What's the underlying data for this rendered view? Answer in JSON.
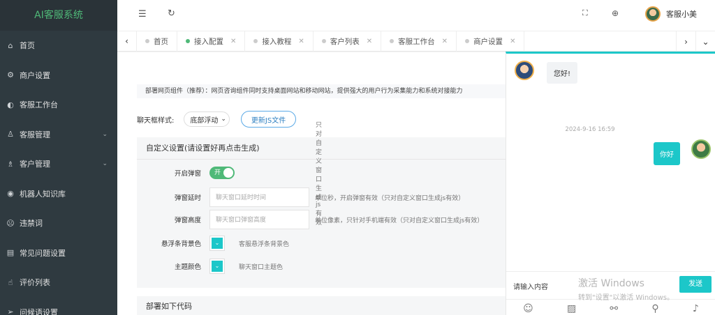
{
  "app": {
    "title": "AI客服系统"
  },
  "sidebar": {
    "items": [
      {
        "label": "首页",
        "icon": "home-icon"
      },
      {
        "label": "商户设置",
        "icon": "gear-icon"
      },
      {
        "label": "客服工作台",
        "icon": "workbench-icon"
      },
      {
        "label": "客服管理",
        "icon": "user-icon",
        "expandable": true
      },
      {
        "label": "客户管理",
        "icon": "customers-icon",
        "expandable": true
      },
      {
        "label": "机器人知识库",
        "icon": "robot-icon"
      },
      {
        "label": "违禁词",
        "icon": "ban-icon"
      },
      {
        "label": "常见问题设置",
        "icon": "faq-icon"
      },
      {
        "label": "评价列表",
        "icon": "thumbs-up-icon"
      },
      {
        "label": "问候语设置",
        "icon": "send-icon"
      }
    ]
  },
  "header": {
    "username": "客服小美"
  },
  "tabs": [
    {
      "label": "首页",
      "closable": false,
      "active": false
    },
    {
      "label": "接入配置",
      "closable": true,
      "active": true
    },
    {
      "label": "接入教程",
      "closable": true,
      "active": false
    },
    {
      "label": "客户列表",
      "closable": true,
      "active": false
    },
    {
      "label": "客服工作台",
      "closable": true,
      "active": false
    },
    {
      "label": "商户设置",
      "closable": true,
      "active": false
    }
  ],
  "main": {
    "notice": "部署网页组件（推荐）：网页咨询组件同时支持桌面网站和移动网站，提供强大的用户行为采集能力和系统对接能力",
    "style_label": "聊天框样式:",
    "style_value": "底部浮动",
    "update_js_button": "更新JS文件",
    "custom_title": "自定义设置(请设置好再点击生成)",
    "fields": {
      "popup": {
        "label": "开启弹窗",
        "toggle": "开",
        "hint": "只对自定义窗口生成js有效"
      },
      "delay": {
        "label": "弹窗延时",
        "placeholder": "聊天窗口延时时间",
        "hint": "单位秒，开启弹窗有效（只对自定义窗口生成js有效）"
      },
      "height": {
        "label": "弹窗高度",
        "placeholder": "聊天窗口弹窗高度",
        "hint": "单位像素，只针对手机端有效（只对自定义窗口生成js有效）"
      },
      "float_bg": {
        "label": "悬浮条背景色",
        "hint": "客服悬浮条背景色"
      },
      "theme": {
        "label": "主题颜色",
        "hint": "聊天窗口主题色"
      }
    },
    "deploy_title": "部署如下代码"
  },
  "chat": {
    "messages": [
      {
        "from": "agent",
        "text": "您好!"
      },
      {
        "from": "user",
        "text": "你好"
      }
    ],
    "timestamp": "2024-9-16 16:59",
    "input_placeholder": "请输入内容",
    "send_label": "发送"
  },
  "watermark": {
    "line1": "激活 Windows",
    "line2": "转到\"设置\"以激活 Windows。"
  },
  "colors": {
    "accent": "#1cc7c9",
    "green": "#4fb978",
    "sidebar_bg": "#2f3a40"
  }
}
